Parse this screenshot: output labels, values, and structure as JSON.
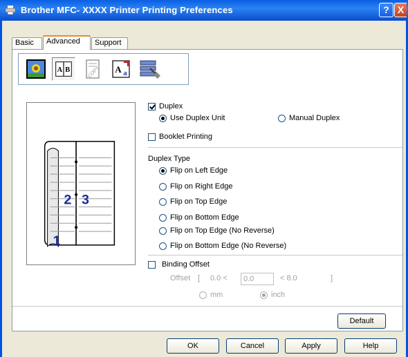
{
  "window": {
    "title": "Brother MFC- XXXX   Printer Printing Preferences",
    "help_glyph": "?",
    "close_glyph": "X"
  },
  "tabs": [
    {
      "label": "Basic"
    },
    {
      "label": "Advanced"
    },
    {
      "label": "Support"
    }
  ],
  "iconbar": {
    "items": [
      "print-quality-icon",
      "duplex-icon",
      "watermark-icon",
      "page-setting-icon",
      "device-options-icon"
    ],
    "selected": "duplex-icon"
  },
  "preview": {
    "left_page_number": "1",
    "middle_page_number": "2",
    "right_page_number": "3"
  },
  "duplex": {
    "label": "Duplex",
    "checked": true,
    "use_unit": "Use Duplex Unit",
    "manual": "Manual Duplex",
    "selected": "use_unit"
  },
  "booklet": {
    "label": "Booklet Printing",
    "checked": false
  },
  "duplex_type": {
    "heading": "Duplex Type",
    "options": [
      "Flip on Left Edge",
      "Flip on Right Edge",
      "Flip on Top Edge",
      "Flip on Bottom Edge",
      "Flip on Top Edge (No Reverse)",
      "Flip on Bottom Edge (No Reverse)"
    ],
    "selected_index": 0
  },
  "binding": {
    "label": "Binding Offset",
    "checked": false,
    "offset_label": "Offset",
    "bracket_open": "[",
    "min": "0.0 <",
    "value": "0.0",
    "max": "< 8.0",
    "bracket_close": "]",
    "unit_mm": "mm",
    "unit_inch": "inch",
    "unit_selected": "inch"
  },
  "buttons": {
    "default": "Default",
    "ok": "OK",
    "cancel": "Cancel",
    "apply": "Apply",
    "help": "Help"
  },
  "colors": {
    "titlebar": "#0a5fe3",
    "dialog_bg": "#ece9d8",
    "tab_highlight": "#e68b2c",
    "check": "#21a121"
  }
}
